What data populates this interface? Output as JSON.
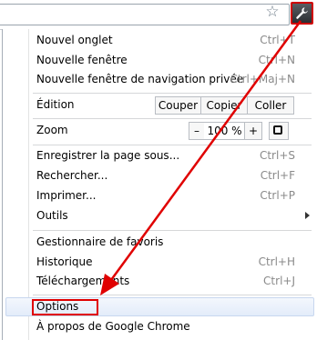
{
  "toolbar": {
    "star_icon": "star-icon",
    "wrench_icon": "wrench-icon"
  },
  "menu": {
    "new_tab": {
      "label": "Nouvel onglet",
      "shortcut": "Ctrl+T"
    },
    "new_window": {
      "label": "Nouvelle fenêtre",
      "shortcut": "Ctrl+N"
    },
    "incognito": {
      "label": "Nouvelle fenêtre de navigation privée",
      "shortcut": "Ctrl+Maj+N"
    },
    "edit": {
      "label": "Édition",
      "cut": "Couper",
      "copy": "Copier",
      "paste": "Coller"
    },
    "zoom": {
      "label": "Zoom",
      "minus": "–",
      "value": "100 %",
      "plus": "+"
    },
    "save_page": {
      "label": "Enregistrer la page sous...",
      "shortcut": "Ctrl+S"
    },
    "find": {
      "label": "Rechercher...",
      "shortcut": "Ctrl+F"
    },
    "print": {
      "label": "Imprimer...",
      "shortcut": "Ctrl+P"
    },
    "tools": {
      "label": "Outils"
    },
    "bookmarks": {
      "label": "Gestionnaire de favoris"
    },
    "history": {
      "label": "Historique",
      "shortcut": "Ctrl+H"
    },
    "downloads": {
      "label": "Téléchargements",
      "shortcut": "Ctrl+J"
    },
    "options": {
      "label": "Options"
    },
    "about": {
      "label": "À propos de Google Chrome"
    }
  },
  "annotation": {
    "color": "#e00000"
  }
}
